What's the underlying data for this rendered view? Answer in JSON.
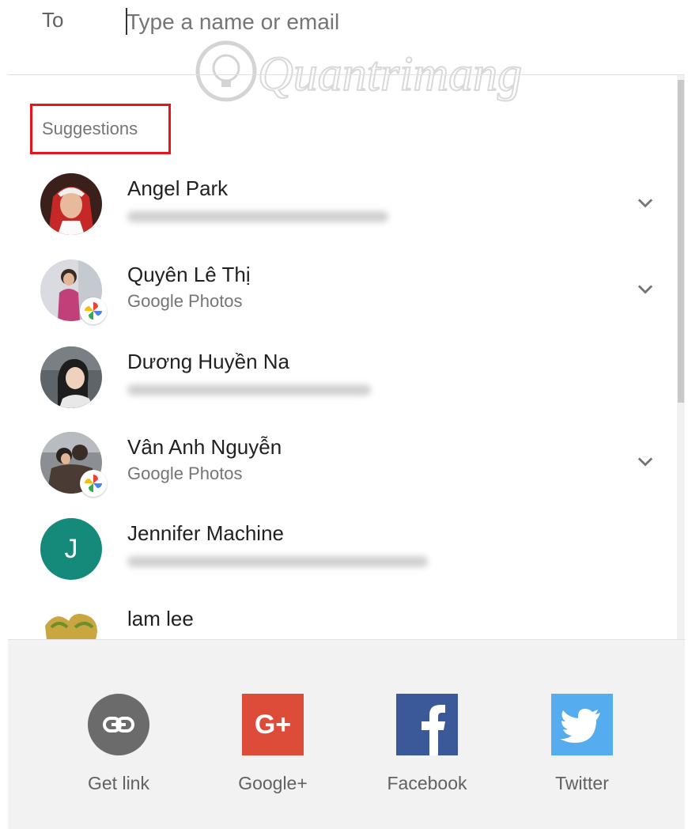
{
  "to_field": {
    "label": "To",
    "placeholder": "Type a name or email"
  },
  "suggestions": {
    "header": "Suggestions",
    "items": [
      {
        "name": "Angel Park",
        "subtitle": "",
        "has_menu": true,
        "badge": ""
      },
      {
        "name": "Quyên Lê Thị",
        "subtitle": "Google Photos",
        "has_menu": true,
        "badge": "google-photos"
      },
      {
        "name": "Dương Huyền Na",
        "subtitle": "",
        "has_menu": false,
        "badge": ""
      },
      {
        "name": "Vân Anh Nguyễn",
        "subtitle": "Google Photos",
        "has_menu": true,
        "badge": "google-photos"
      },
      {
        "name": "Jennifer Machine",
        "subtitle": "",
        "has_menu": false,
        "badge": "",
        "initial": "J",
        "avatar_color": "#168a7a"
      },
      {
        "name": "lam lee",
        "subtitle": "",
        "has_menu": false,
        "badge": ""
      }
    ]
  },
  "share": {
    "items": [
      {
        "label": "Get link",
        "icon": "link-icon",
        "color": "#6b6b6b"
      },
      {
        "label": "Google+",
        "icon": "google-plus-icon",
        "color": "#dd4b39"
      },
      {
        "label": "Facebook",
        "icon": "facebook-icon",
        "color": "#3b5998"
      },
      {
        "label": "Twitter",
        "icon": "twitter-icon",
        "color": "#55acee"
      }
    ]
  },
  "watermark": "Quantrimang",
  "colors": {
    "highlight_box": "#e8141b",
    "share_bar_bg": "#f2f2f2"
  }
}
